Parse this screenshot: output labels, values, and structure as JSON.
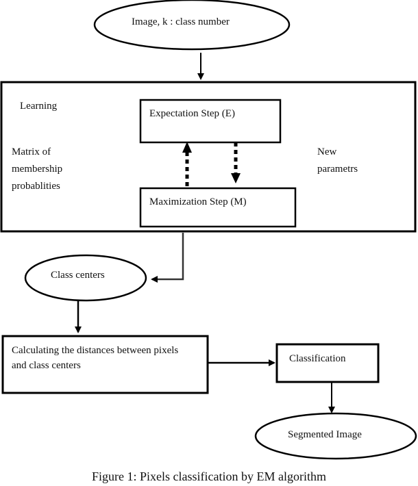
{
  "diagram": {
    "input_node": "Image, k : class number",
    "learning_box": {
      "label": "Learning",
      "left_note": [
        "Matrix of",
        "membership",
        "probablities"
      ],
      "right_note": [
        "New",
        "parametrs"
      ],
      "e_step": "Expectation Step (E)",
      "m_step": "Maximization Step (M)"
    },
    "class_centers_node": "Class centers",
    "distance_node": [
      "Calculating the distances between pixels",
      "and class centers"
    ],
    "classification_node": "Classification",
    "output_node": "Segmented Image",
    "caption": "Figure 1: Pixels classification by EM algorithm"
  }
}
